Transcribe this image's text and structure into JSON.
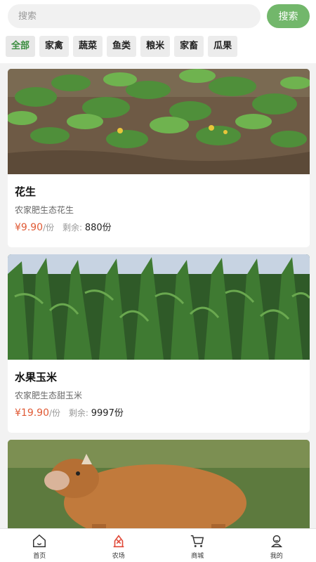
{
  "search": {
    "placeholder": "搜索",
    "button_label": "搜索"
  },
  "categories": [
    {
      "label": "全部",
      "active": true
    },
    {
      "label": "家禽"
    },
    {
      "label": "蔬菜"
    },
    {
      "label": "鱼类"
    },
    {
      "label": "粮米"
    },
    {
      "label": "家畜"
    },
    {
      "label": "瓜果"
    }
  ],
  "products": [
    {
      "title": "花生",
      "desc": "农家肥生态花生",
      "price": "¥9.90",
      "unit": "/份",
      "remain_label": "剩余:",
      "remain_value": "880份",
      "image": "peanut-plants"
    },
    {
      "title": "水果玉米",
      "desc": "农家肥生态甜玉米",
      "price": "¥19.90",
      "unit": "/份",
      "remain_label": "剩余:",
      "remain_value": "9997份",
      "image": "corn-field"
    },
    {
      "title": "",
      "desc": "",
      "image": "cow"
    }
  ],
  "tabbar": {
    "items": [
      {
        "label": "首页",
        "icon": "home-icon"
      },
      {
        "label": "农场",
        "icon": "farm-icon",
        "active": true
      },
      {
        "label": "商城",
        "icon": "cart-icon"
      },
      {
        "label": "我的",
        "icon": "profile-icon"
      }
    ]
  },
  "colors": {
    "accent": "#72b76b",
    "price": "#e05a35",
    "active_tab": "#e04a3a",
    "active_category": "#3a8d3f"
  }
}
